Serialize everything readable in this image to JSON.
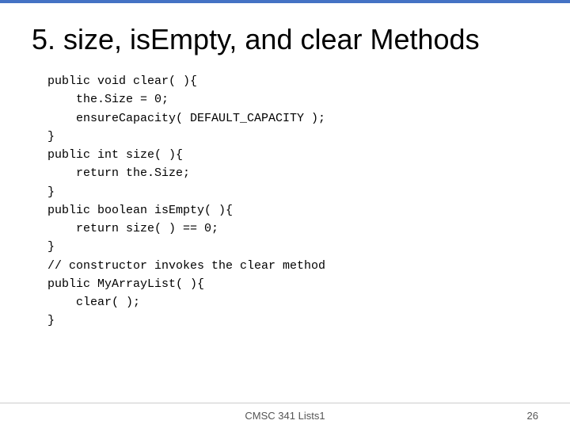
{
  "slide": {
    "top_border_color": "#4472c4",
    "title": "5. size, isEmpty, and clear Methods",
    "code": [
      "public void clear( ){",
      "    the.Size = 0;",
      "    ensureCapacity( DEFAULT_CAPACITY );",
      "}",
      "public int size( ){",
      "    return the.Size;",
      "}",
      "public boolean isEmpty( ){",
      "    return size( ) == 0;",
      "}",
      "// constructor invokes the clear method",
      "public MyArrayList( ){",
      "    clear( );",
      "}"
    ],
    "footer": {
      "center": "CMSC 341 Lists1",
      "page_number": "26"
    }
  }
}
